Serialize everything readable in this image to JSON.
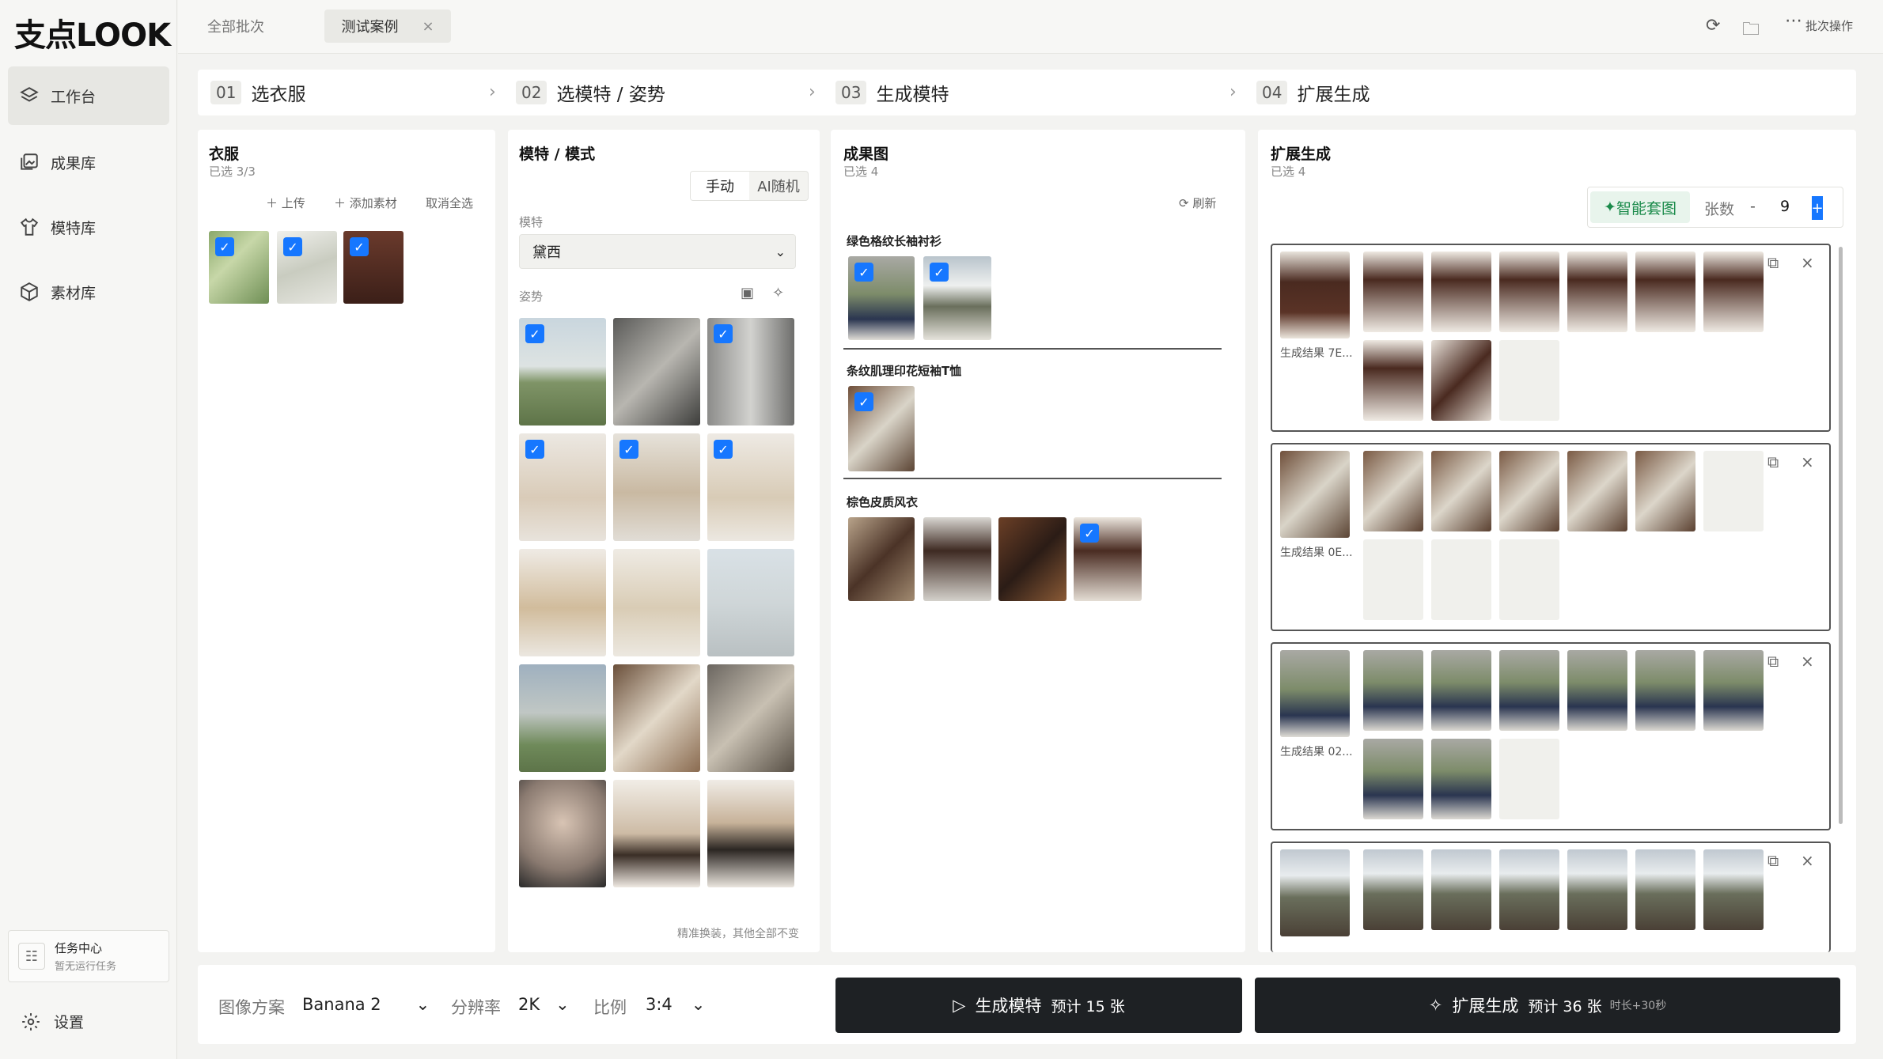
{
  "app": {
    "logo": "支点LOOK"
  },
  "sidebar": {
    "items": [
      {
        "label": "工作台",
        "icon": "layers-icon"
      },
      {
        "label": "成果库",
        "icon": "gallery-icon"
      },
      {
        "label": "模特库",
        "icon": "shirt-icon"
      },
      {
        "label": "素材库",
        "icon": "cube-icon"
      }
    ],
    "task_center": {
      "title": "任务中心",
      "status": "暂无运行任务"
    },
    "settings": "设置"
  },
  "topbar": {
    "tab_all": "全部批次",
    "tab_active": "测试案例",
    "close": "×",
    "batch_op": "批次操作"
  },
  "steps": [
    {
      "num": "01",
      "label": "选衣服"
    },
    {
      "num": "02",
      "label": "选模特 / 姿势"
    },
    {
      "num": "03",
      "label": "生成模特"
    },
    {
      "num": "04",
      "label": "扩展生成"
    }
  ],
  "clothes": {
    "title": "衣服",
    "selected": "已选 3/3",
    "upload": "上传",
    "add_material": "添加素材",
    "deselect_all": "取消全选"
  },
  "model": {
    "title": "模特 / 模式",
    "mode_manual": "手动",
    "mode_ai": "AI随机",
    "model_label": "模特",
    "model_value": "黛西",
    "pose_label": "姿势",
    "footnote": "精准换装，其他全部不变"
  },
  "results": {
    "title": "成果图",
    "selected": "已选 4",
    "refresh": "刷新",
    "groups": [
      "绿色格纹长袖衬衫",
      "条纹肌理印花短袖T恤",
      "棕色皮质风衣"
    ]
  },
  "expand": {
    "title": "扩展生成",
    "selected": "已选 4",
    "smart_set": "智能套图",
    "count_label": "张数",
    "minus": "-",
    "count": "9",
    "plus": "+",
    "group_labels": [
      "生成结果 7E...",
      "生成结果 0E...",
      "生成结果 02..."
    ]
  },
  "bottom": {
    "scheme_label": "图像方案",
    "scheme_value": "Banana 2",
    "res_label": "分辨率",
    "res_value": "2K",
    "ratio_label": "比例",
    "ratio_value": "3:4",
    "gen_model": "生成模特",
    "gen_model_est": "预计 15 张",
    "expand_gen": "扩展生成",
    "expand_est": "预计 36 张",
    "expand_extra": "时长+30秒"
  },
  "colors": {
    "accent": "#1677ff",
    "dark_button": "#1e2124",
    "smart_green": "#1a8a4a"
  }
}
